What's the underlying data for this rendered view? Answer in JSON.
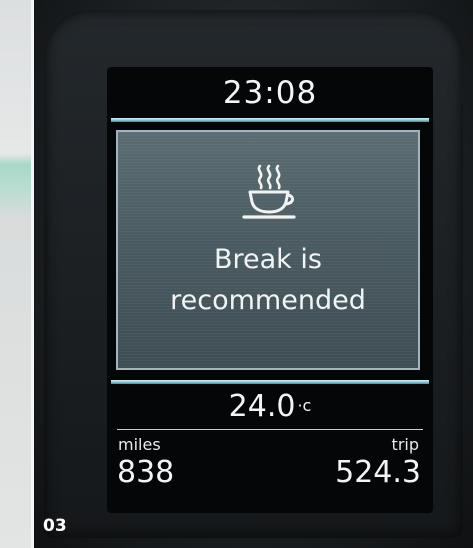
{
  "display": {
    "time": "23:08",
    "alert": {
      "icon": "coffee-cup-icon",
      "line1": "Break is",
      "line2": "recommended"
    },
    "temperature": {
      "value": "24.0",
      "unit": "·c"
    },
    "odometer": {
      "label": "miles",
      "value": "838"
    },
    "trip": {
      "label": "trip",
      "value": "524.3"
    }
  },
  "figure_number": "03",
  "colors": {
    "accent_divider": "#7fc3d3",
    "panel_background": "#4a5b61",
    "text": "#f3f4f4"
  }
}
